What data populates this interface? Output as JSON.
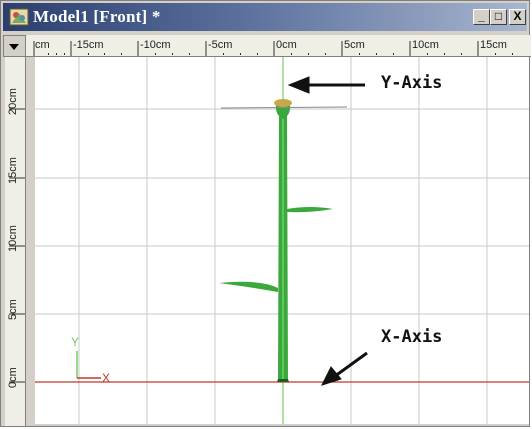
{
  "window": {
    "title": "Model1 [Front] *",
    "buttons": {
      "minimize": "_",
      "maximize": "□",
      "close": "X"
    }
  },
  "ruler": {
    "horizontal": [
      "cm",
      "-15cm",
      "-10cm",
      "-5cm",
      "0cm",
      "5cm",
      "10cm",
      "15cm"
    ],
    "vertical": [
      "20cm",
      "15cm",
      "10cm",
      "5cm",
      "0cm"
    ]
  },
  "viewport": {
    "annotations": {
      "y_axis": "Y-Axis",
      "x_axis": "X-Axis"
    },
    "triad": {
      "y": "Y",
      "x": "X"
    },
    "colors": {
      "grid": "#c8c8c8",
      "x_axis": "#c0392b",
      "y_axis": "#7acc6a",
      "stem": "#3aa83a",
      "flower": "#c9a84a",
      "arrow": "#111111"
    }
  }
}
